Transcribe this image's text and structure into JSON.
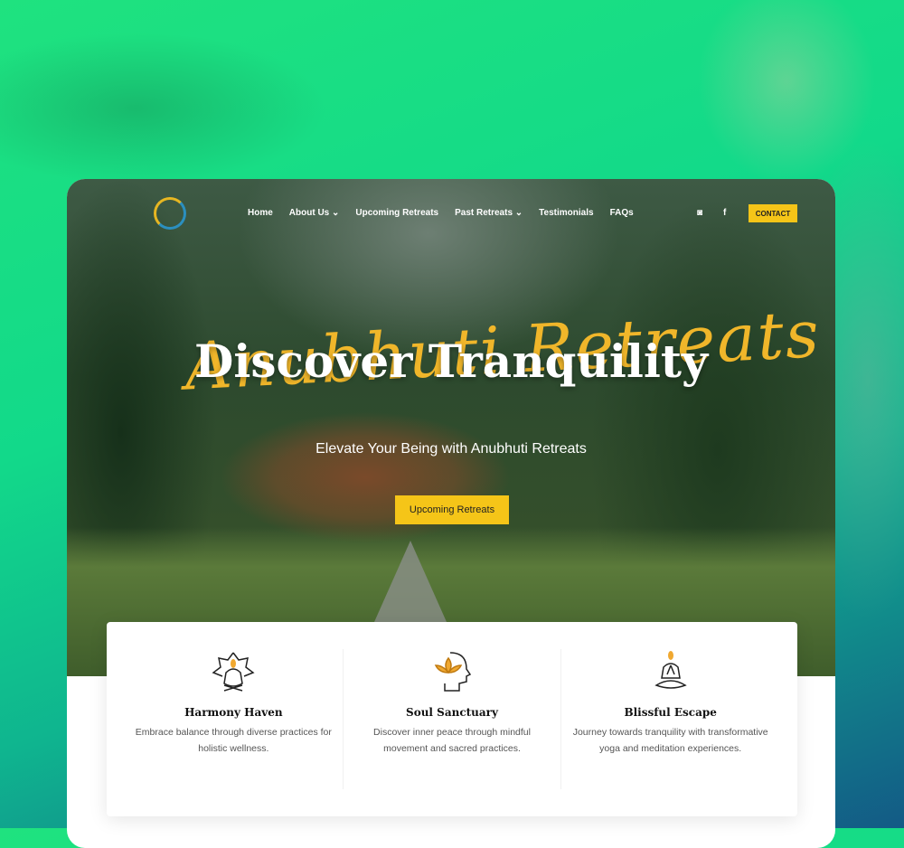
{
  "nav": {
    "items": [
      {
        "label": "Home"
      },
      {
        "label": "About Us ⌄"
      },
      {
        "label": "Upcoming Retreats"
      },
      {
        "label": "Past Retreats ⌄"
      },
      {
        "label": "Testimonials"
      },
      {
        "label": "FAQs"
      }
    ],
    "contact_label": "CONTACT",
    "social": [
      "instagram-icon",
      "facebook-icon"
    ]
  },
  "hero": {
    "script_text": "Anubhuti Retreats",
    "title": "Discover Tranquility",
    "subtitle": "Elevate Your Being with Anubhuti Retreats",
    "cta_label": "Upcoming Retreats"
  },
  "features": [
    {
      "title": "Harmony Haven",
      "text": "Embrace balance through diverse practices for holistic wellness.",
      "icon": "lotus-meditation-icon"
    },
    {
      "title": "Soul Sanctuary",
      "text": "Discover inner peace through mindful movement and sacred practices.",
      "icon": "lotus-head-icon"
    },
    {
      "title": "Blissful Escape",
      "text": "Journey towards tranquility with transformative yoga and meditation experiences.",
      "icon": "meditating-person-icon"
    }
  ],
  "colors": {
    "accent": "#f5c518",
    "icon_accent": "#f0a830"
  }
}
